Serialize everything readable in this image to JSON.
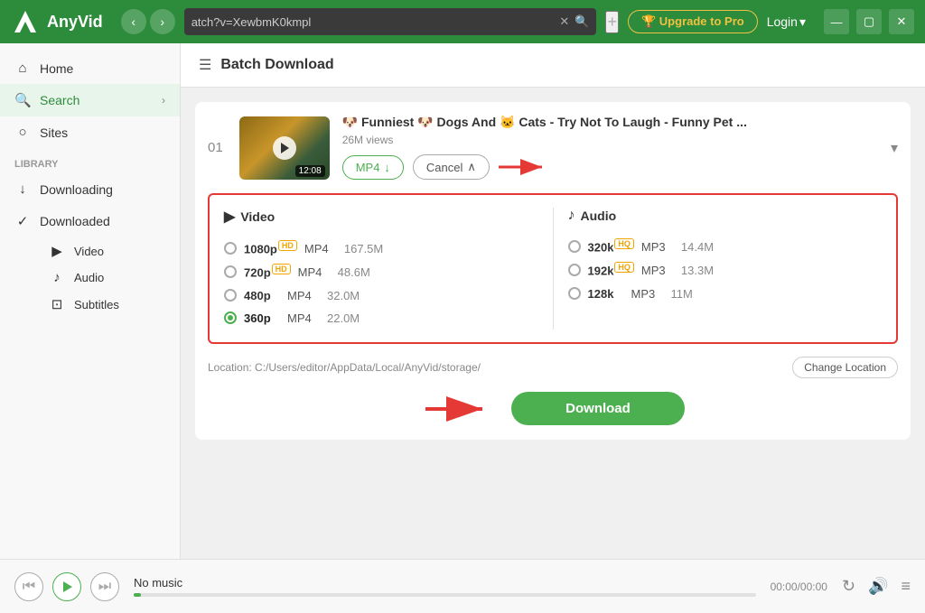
{
  "app": {
    "name": "AnyVid",
    "tab_url": "atch?v=XewbmK0kmpl",
    "upgrade_label": "🏆 Upgrade to Pro",
    "login_label": "Login"
  },
  "sidebar": {
    "home_label": "Home",
    "search_label": "Search",
    "sites_label": "Sites",
    "library_label": "Library",
    "downloading_label": "Downloading",
    "downloaded_label": "Downloaded",
    "video_label": "Video",
    "audio_label": "Audio",
    "subtitles_label": "Subtitles"
  },
  "page": {
    "title": "Batch Download"
  },
  "video": {
    "number": "01",
    "duration": "12:08",
    "title": "🐶 Funniest 🐶 Dogs And 🐱 Cats - Try Not To Laugh - Funny Pet ...",
    "views": "26M views",
    "format_label": "MP4",
    "cancel_label": "Cancel"
  },
  "formats": {
    "video_header": "Video",
    "audio_header": "Audio",
    "video_options": [
      {
        "res": "1080p",
        "badge": "HD",
        "type": "MP4",
        "size": "167.5M",
        "selected": false
      },
      {
        "res": "720p",
        "badge": "HD",
        "type": "MP4",
        "size": "48.6M",
        "selected": false
      },
      {
        "res": "480p",
        "badge": "",
        "type": "MP4",
        "size": "32.0M",
        "selected": false
      },
      {
        "res": "360p",
        "badge": "",
        "type": "MP4",
        "size": "22.0M",
        "selected": true
      }
    ],
    "audio_options": [
      {
        "res": "320k",
        "badge": "HQ",
        "type": "MP3",
        "size": "14.4M",
        "selected": false
      },
      {
        "res": "192k",
        "badge": "HQ",
        "type": "MP3",
        "size": "13.3M",
        "selected": false
      },
      {
        "res": "128k",
        "badge": "",
        "type": "MP3",
        "size": "11M",
        "selected": false
      }
    ]
  },
  "location": {
    "label": "Location: C:/Users/editor/AppData/Local/AnyVid/storage/",
    "change_label": "Change Location"
  },
  "download": {
    "label": "Download"
  },
  "player": {
    "title": "No music",
    "time": "00:00/00:00"
  }
}
